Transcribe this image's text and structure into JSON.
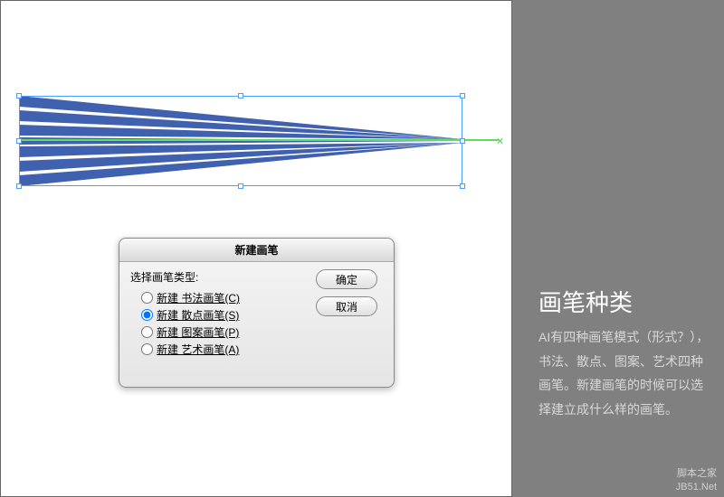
{
  "dialog": {
    "title": "新建画笔",
    "label": "选择画笔类型:",
    "options": [
      {
        "label": "新建 书法画笔(C)",
        "checked": false
      },
      {
        "label": "新建 散点画笔(S)",
        "checked": true
      },
      {
        "label": "新建 图案画笔(P)",
        "checked": false
      },
      {
        "label": "新建 艺术画笔(A)",
        "checked": false
      }
    ],
    "ok": "确定",
    "cancel": "取消"
  },
  "side": {
    "title": "画笔种类",
    "text": "AI有四种画笔模式（形式？），书法、散点、图案、艺术四种画笔。新建画笔的时候可以选择建立成什么样的画笔。"
  },
  "watermark": {
    "line1": "脚本之家",
    "line2": "JB51.Net"
  },
  "colors": {
    "brush": "#4060b0",
    "sel": "#4a9eff",
    "guide": "#5fdd5f"
  }
}
